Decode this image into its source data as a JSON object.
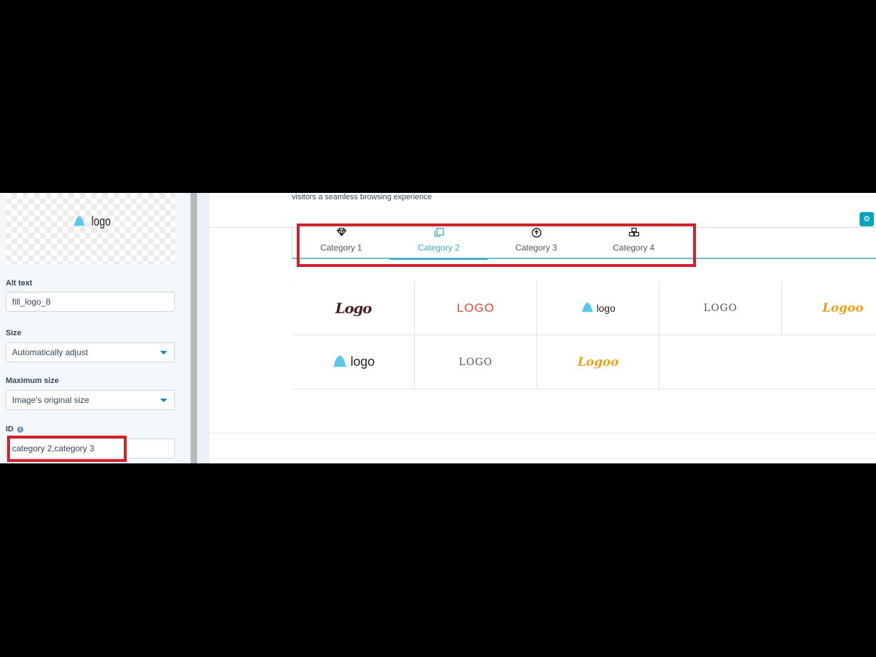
{
  "panel": {
    "preview_logo_text": "logo",
    "alt_text": {
      "label": "Alt text",
      "value": "fill_logo_8"
    },
    "size": {
      "label": "Size",
      "value": "Automatically adjust"
    },
    "max_size": {
      "label": "Maximum size",
      "value": "Image's original size"
    },
    "id_field": {
      "label": "ID",
      "value": "category 2,category 3"
    }
  },
  "canvas": {
    "intro_text": "visitors a seamless browsing experience",
    "tabs": [
      {
        "label": "Category 1",
        "icon": "diamond-icon"
      },
      {
        "label": "Category 2",
        "icon": "copy-icon",
        "active": true
      },
      {
        "label": "Category 3",
        "icon": "arrow-up-circle-icon"
      },
      {
        "label": "Category 4",
        "icon": "cubes-icon"
      }
    ],
    "logos": [
      {
        "text": "Logo",
        "color": "#4a1f1f",
        "style": "script"
      },
      {
        "text": "LOGO",
        "color": "#e34a2f",
        "style": "stagger"
      },
      {
        "text": "logo",
        "color": "#222222",
        "style": "bell"
      },
      {
        "text": "LOGO",
        "color": "#555555",
        "style": "serif"
      },
      {
        "text": "Logoo",
        "color": "#f0a21b",
        "style": "script"
      },
      {
        "text": "logo",
        "color": "#222222",
        "style": "bell"
      },
      {
        "text": "LOGO",
        "color": "#555555",
        "style": "serif"
      },
      {
        "text": "Logoo",
        "color": "#f0a21b",
        "style": "script"
      }
    ]
  },
  "colors": {
    "accent": "#00a4bd",
    "highlight": "#d0202d",
    "active_tab": "#3aaab8"
  }
}
